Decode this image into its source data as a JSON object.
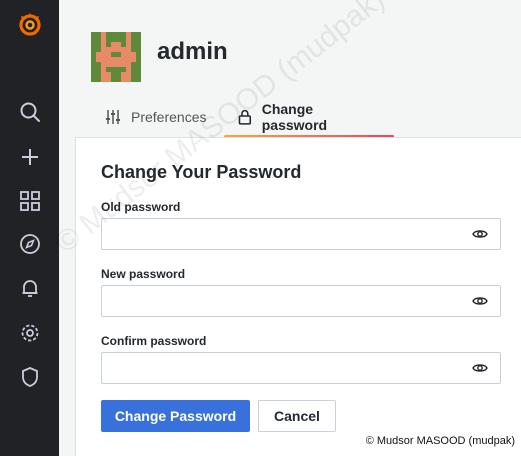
{
  "profile": {
    "username": "admin"
  },
  "tabs": [
    {
      "label": "Preferences",
      "icon": "sliders-icon",
      "active": false
    },
    {
      "label": "Change password",
      "icon": "lock-icon",
      "active": true
    }
  ],
  "form": {
    "title": "Change Your Password",
    "fields": [
      {
        "label": "Old password",
        "value": "",
        "icon": "eye-icon"
      },
      {
        "label": "New password",
        "value": "",
        "icon": "eye-icon"
      },
      {
        "label": "Confirm password",
        "value": "",
        "icon": "eye-icon"
      }
    ],
    "submit_label": "Change Password",
    "cancel_label": "Cancel"
  },
  "sidebar": {
    "items": [
      "grafana-logo-icon",
      "search-icon",
      "plus-icon",
      "dashboards-icon",
      "explore-compass-icon",
      "alerting-bell-icon",
      "configuration-gear-icon",
      "server-admin-shield-icon"
    ]
  },
  "watermark": {
    "diagonal": "© Mudsor MASOOD (mudpak)",
    "corner": "© Mudsor MASOOD (mudpak)"
  },
  "colors": {
    "primary": "#3871dc",
    "sidebar": "#202226",
    "tab_accent_start": "#f9a63a",
    "tab_accent_end": "#e9475b"
  }
}
